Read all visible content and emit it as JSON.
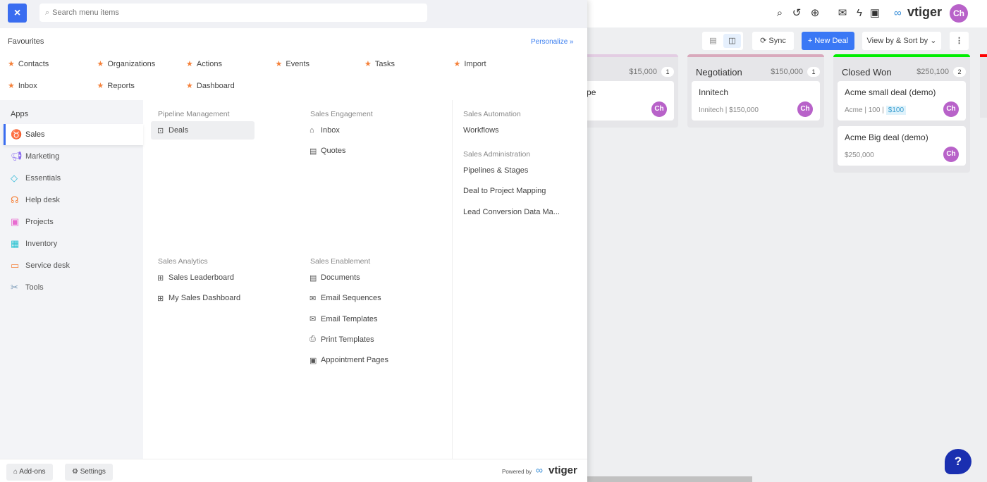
{
  "app": {
    "brand": "vtiger",
    "user_initials": "Ch",
    "toolbar": {
      "sync": "Sync",
      "new_deal": "+ New Deal",
      "view_sort": "View by & Sort by"
    },
    "columns": [
      {
        "title": "osition",
        "amount": "$15,000",
        "count": "1",
        "color": "#e3cde3",
        "cards": [
          {
            "name": "am Shoppe",
            "meta": ""
          }
        ]
      },
      {
        "title": "Negotiation",
        "amount": "$150,000",
        "count": "1",
        "color": "#d9a9bc",
        "cards": [
          {
            "name": "Innitech",
            "meta": "Innitech  |  $150,000"
          }
        ]
      },
      {
        "title": "Closed Won",
        "amount": "$250,100",
        "count": "2",
        "color": "#00ee00",
        "cards": [
          {
            "name": "Acme small deal (demo)",
            "meta": "Acme  |  100 |",
            "tag": "$100"
          },
          {
            "name": "Acme Big deal (demo)",
            "meta": "$250,000"
          }
        ]
      }
    ]
  },
  "menu": {
    "close": "×",
    "search_placeholder": "Search menu items",
    "favourites_title": "Favourites",
    "personalize": "Personalize »",
    "favourites": [
      "Contacts",
      "Organizations",
      "Actions",
      "Events",
      "Tasks",
      "Import",
      "Inbox",
      "Reports",
      "Dashboard"
    ],
    "apps_title": "Apps",
    "apps": [
      "Sales",
      "Marketing",
      "Essentials",
      "Help desk",
      "Projects",
      "Inventory",
      "Service desk",
      "Tools"
    ],
    "sections": {
      "pipeline": {
        "title": "Pipeline Management",
        "items": [
          "Deals"
        ]
      },
      "engagement": {
        "title": "Sales Engagement",
        "items": [
          "Inbox",
          "Quotes"
        ]
      },
      "automation": {
        "title": "Sales Automation",
        "items": [
          "Workflows"
        ]
      },
      "administration": {
        "title": "Sales Administration",
        "items": [
          "Pipelines & Stages",
          "Deal to Project Mapping",
          "Lead Conversion Data Ma..."
        ]
      },
      "analytics": {
        "title": "Sales Analytics",
        "items": [
          "Sales Leaderboard",
          "My Sales Dashboard"
        ]
      },
      "enablement": {
        "title": "Sales Enablement",
        "items": [
          "Documents",
          "Email Sequences",
          "Email Templates",
          "Print Templates",
          "Appointment Pages"
        ]
      }
    },
    "footer": {
      "addons": "Add-ons",
      "settings": "Settings",
      "powered_by": "Powered by"
    }
  },
  "colors": {
    "accent": "#3a6df0",
    "star": "#f5813a",
    "avatar": "#b862c9"
  }
}
